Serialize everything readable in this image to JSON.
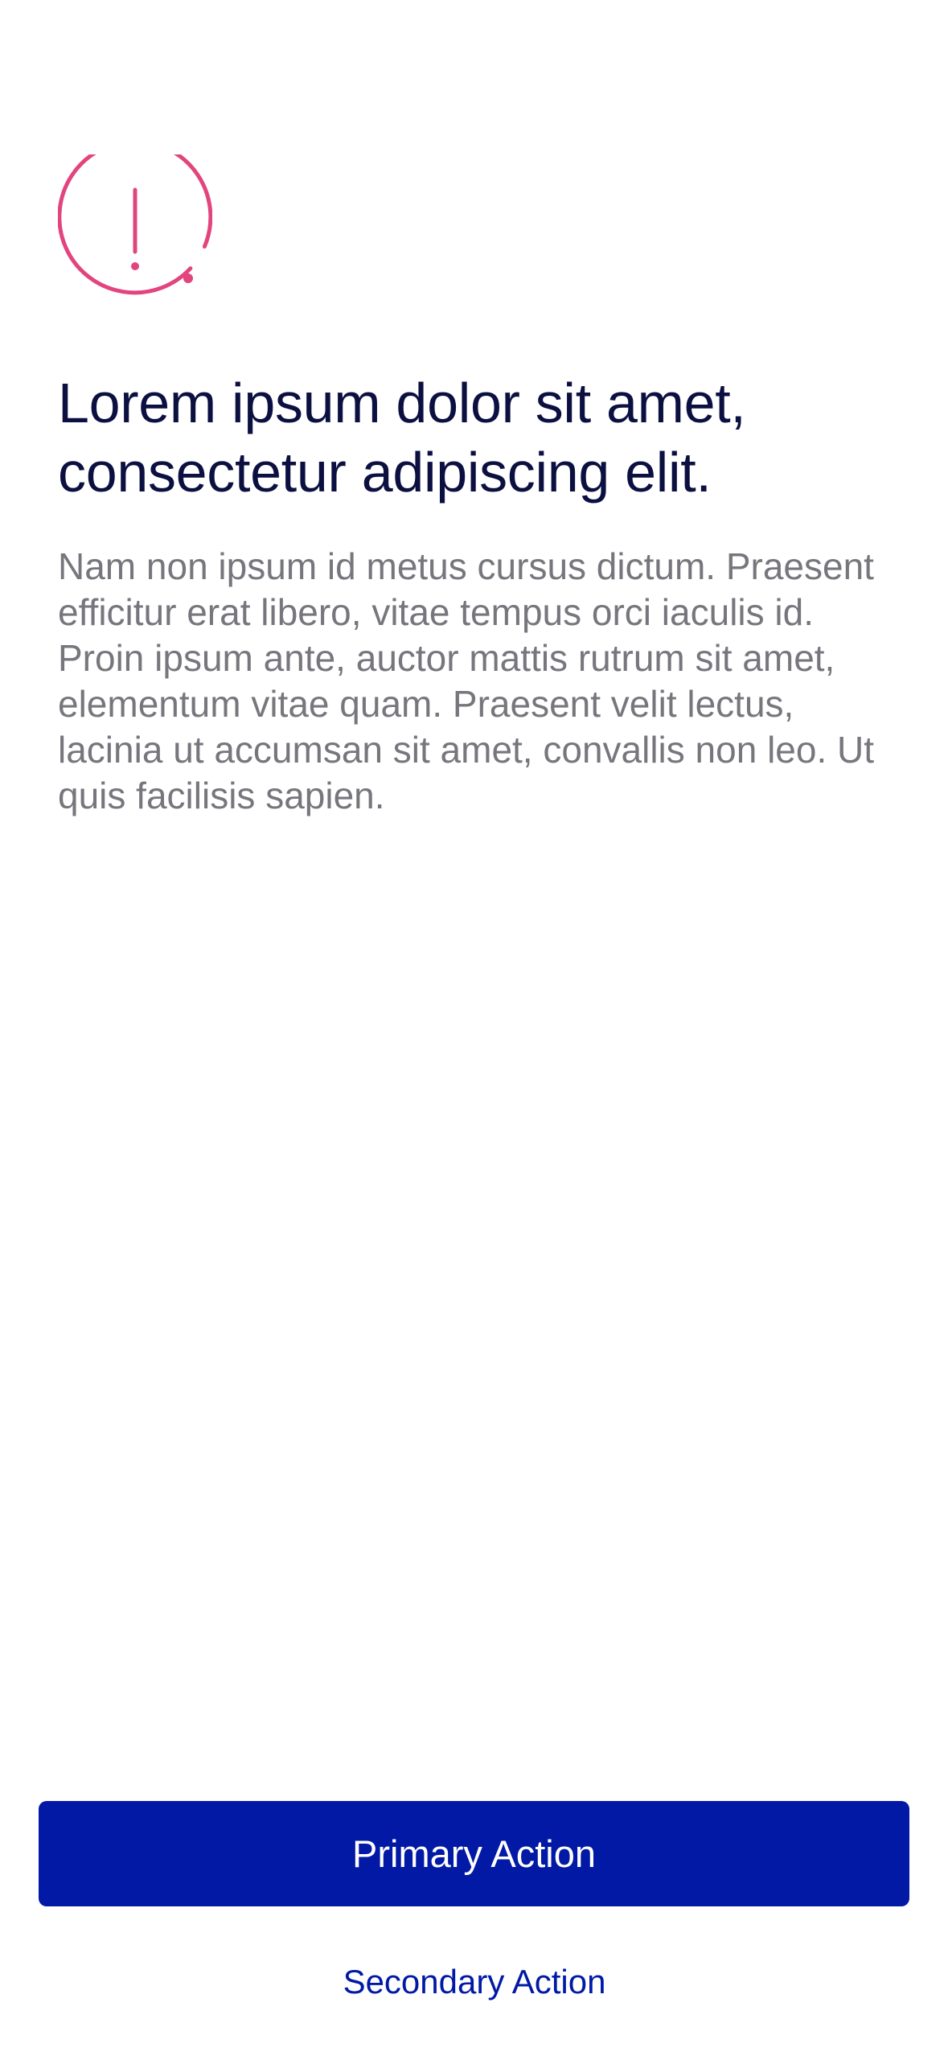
{
  "alert": {
    "icon": "exclamation-circle-icon",
    "accent_color": "#e2457e"
  },
  "content": {
    "headline": "Lorem ipsum dolor sit amet, consectetur adipiscing elit.",
    "body": "Nam non ipsum id metus cursus dictum. Praesent efficitur erat libero, vitae tempus orci iaculis id. Proin ipsum ante, auctor mattis rutrum sit amet, elementum vitae quam. Praesent velit lectus, lacinia ut accumsan sit amet, convallis non leo. Ut quis facilisis sapien."
  },
  "actions": {
    "primary_label": "Primary Action",
    "secondary_label": "Secondary Action",
    "brand_color": "#0119a5"
  }
}
